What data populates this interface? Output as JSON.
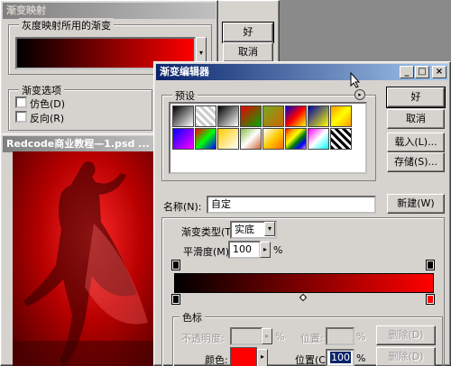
{
  "gradient_map": {
    "title": "渐变映射",
    "group_label": "灰度映射所用的渐变",
    "ok_label": "好",
    "cancel_label": "取消",
    "options_label": "渐变选项",
    "dither_label": "仿色(D)",
    "reverse_label": "反向(R)"
  },
  "document": {
    "title": "Redcode商业教程—1.psd ..."
  },
  "gradient_editor": {
    "title": "渐变编辑器",
    "presets_label": "预设",
    "ok_label": "好",
    "cancel_label": "取消",
    "load_label": "载入(L)...",
    "save_label": "存储(S)...",
    "name_label": "名称(N):",
    "name_value": "自定",
    "new_label": "新建(W)",
    "type_label": "渐变类型(T):",
    "type_value": "实底",
    "smoothness_label": "平滑度(M):",
    "smoothness_value": "100",
    "percent": "%",
    "stops_label": "色标",
    "opacity_label": "不透明度:",
    "location_label_top": "位置:",
    "delete_label_top": "删除(D)",
    "color_label": "颜色:",
    "location_label": "位置(C):",
    "location_value": "100",
    "delete_label": "删除(D)"
  },
  "colors": {
    "accent": "#0a246a",
    "gradient_start": "#000000",
    "gradient_end": "#ff0000",
    "stop_color": "#ff0000"
  }
}
